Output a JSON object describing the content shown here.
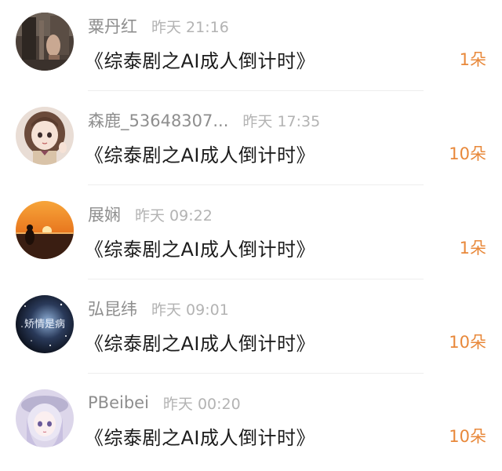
{
  "gifts": [
    {
      "username": "粟丹红",
      "time": "昨天 21:16",
      "title": "《综泰剧之AI成人倒计时》",
      "count": "1朵",
      "avatar_icon": "avatar-photo-icon"
    },
    {
      "username": "森鹿_53648307...",
      "time": "昨天 17:35",
      "title": "《综泰剧之AI成人倒计时》",
      "count": "10朵",
      "avatar_icon": "avatar-anime-girl-icon"
    },
    {
      "username": "展娴",
      "time": "昨天 09:22",
      "title": "《综泰剧之AI成人倒计时》",
      "count": "1朵",
      "avatar_icon": "avatar-sunset-icon"
    },
    {
      "username": "弘昆纬",
      "time": "昨天 09:01",
      "title": "《综泰剧之AI成人倒计时》",
      "count": "10朵",
      "avatar_icon": "avatar-starry-icon",
      "avatar_text": "矫情是病"
    },
    {
      "username": "PBeibei",
      "time": "昨天 00:20",
      "title": "《综泰剧之AI成人倒计时》",
      "count": "10朵",
      "avatar_icon": "avatar-anime-hat-icon"
    }
  ],
  "colors": {
    "count": "#e8883a",
    "username": "#8e8e8e",
    "time": "#b3b3b3",
    "title": "#1c1c1c"
  }
}
